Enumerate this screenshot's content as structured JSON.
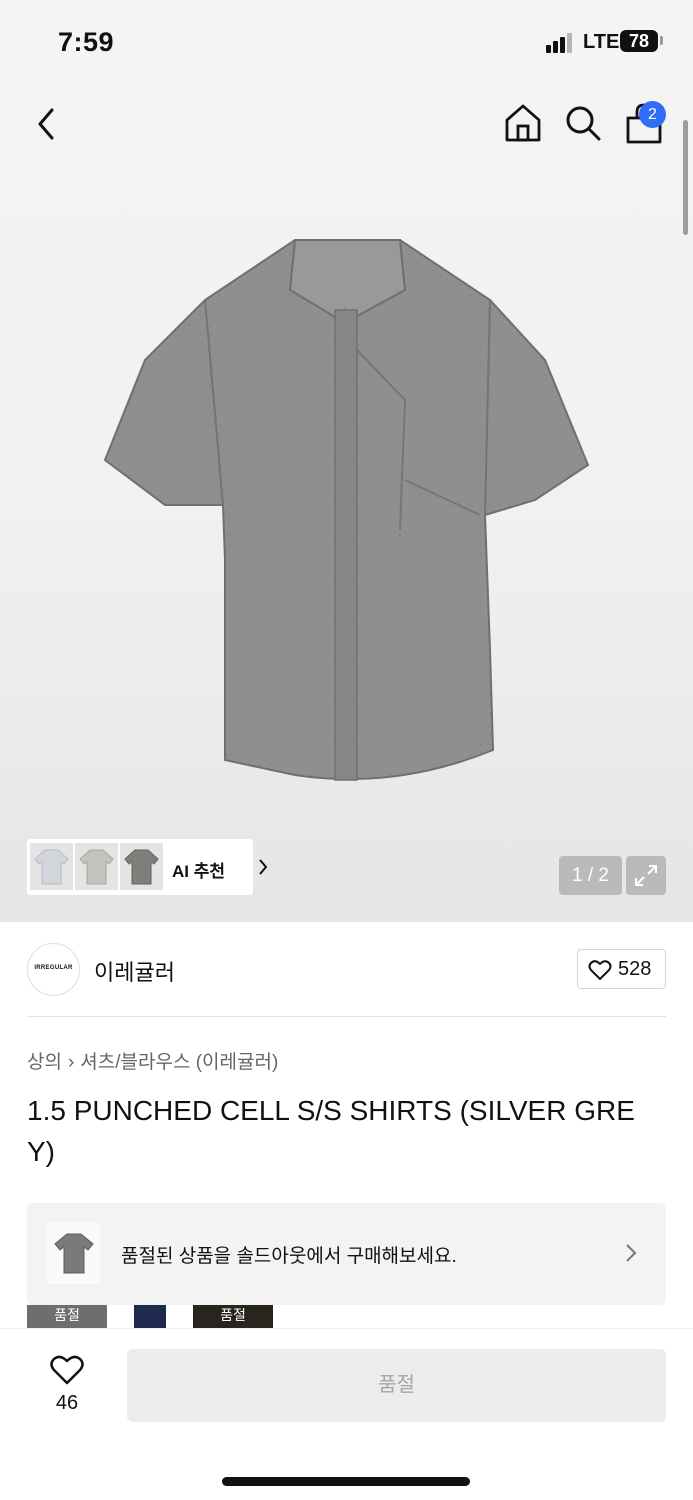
{
  "status_bar": {
    "time": "7:59",
    "network": "LTE",
    "battery": "78"
  },
  "header": {
    "cart_count": "2"
  },
  "gallery": {
    "ai_label": "AI 추천",
    "pager": "1 / 2"
  },
  "brand": {
    "logo_text": "IRREGULAR",
    "name": "이레귤러",
    "likes": "528"
  },
  "breadcrumb": {
    "category": "상의",
    "subcategory": "셔츠/블라우스 (이레귤러)"
  },
  "product": {
    "title": "1.5 PUNCHED CELL S/S SHIRTS (SILVER GREY)"
  },
  "banner": {
    "text": "품절된 상품을 솔드아웃에서 구매해보세요."
  },
  "swatches": [
    {
      "label": "품절",
      "color": "#6e6e6e"
    },
    {
      "label": "",
      "color": "#1f2a4f"
    },
    {
      "label": "품절",
      "color": "#2a241f"
    }
  ],
  "bottom": {
    "likes": "46",
    "button_label": "품절"
  },
  "colors": {
    "accent": "#2f6df6"
  }
}
